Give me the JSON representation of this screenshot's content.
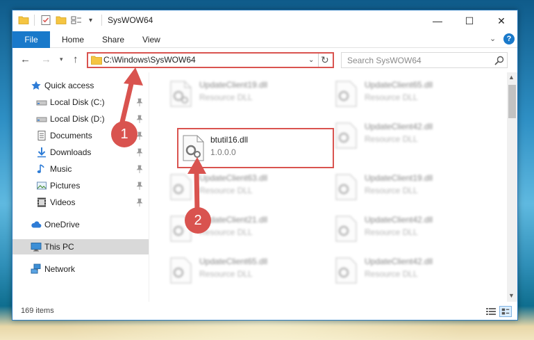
{
  "window": {
    "title": "SysWOW64",
    "controls": {
      "minimize": "—",
      "maximize": "☐",
      "close": "✕"
    }
  },
  "ribbon": {
    "tabs": [
      "File",
      "Home",
      "Share",
      "View"
    ],
    "help": "?"
  },
  "navigation": {
    "address": "C:\\Windows\\SysWOW64",
    "search_placeholder": "Search SysWOW64"
  },
  "sidebar": {
    "items": [
      {
        "label": "Quick access",
        "icon": "star-icon",
        "pinned": false
      },
      {
        "label": "Local Disk (C:)",
        "icon": "drive-icon",
        "pinned": true
      },
      {
        "label": "Local Disk (D:)",
        "icon": "drive-icon",
        "pinned": true
      },
      {
        "label": "Documents",
        "icon": "documents-icon",
        "pinned": true
      },
      {
        "label": "Downloads",
        "icon": "download-icon",
        "pinned": true
      },
      {
        "label": "Music",
        "icon": "music-icon",
        "pinned": true
      },
      {
        "label": "Pictures",
        "icon": "pictures-icon",
        "pinned": true
      },
      {
        "label": "Videos",
        "icon": "videos-icon",
        "pinned": true
      },
      {
        "label": "OneDrive",
        "icon": "cloud-icon",
        "pinned": false
      },
      {
        "label": "This PC",
        "icon": "computer-icon",
        "pinned": false,
        "selected": true
      },
      {
        "label": "Network",
        "icon": "network-icon",
        "pinned": false
      }
    ]
  },
  "files": {
    "left_column": [
      {
        "name": "UpdateClient19.dll",
        "sub": "Resource DLL"
      },
      {
        "name": "btutil16.dll",
        "sub": "1.0.0.0",
        "highlighted": true
      },
      {
        "name": "UpdateClient63.dll",
        "sub": "Resource DLL"
      },
      {
        "name": "UpdateClient21.dll",
        "sub": "Resource DLL"
      },
      {
        "name": "UpdateClient65.dll",
        "sub": "Resource DLL"
      }
    ],
    "right_column": [
      {
        "name": "UpdateClient65.dll",
        "sub": "Resource DLL"
      },
      {
        "name": "UpdateClient42.dll",
        "sub": "Resource DLL"
      },
      {
        "name": "UpdateClient19.dll",
        "sub": "Resource DLL"
      },
      {
        "name": "UpdateClient42.dll",
        "sub": "Resource DLL"
      },
      {
        "name": "UpdateClient42.dll",
        "sub": "Resource DLL"
      }
    ]
  },
  "status": {
    "item_count": "169 items"
  },
  "annotations": {
    "step1": "1",
    "step2": "2",
    "color": "#d9534f"
  }
}
